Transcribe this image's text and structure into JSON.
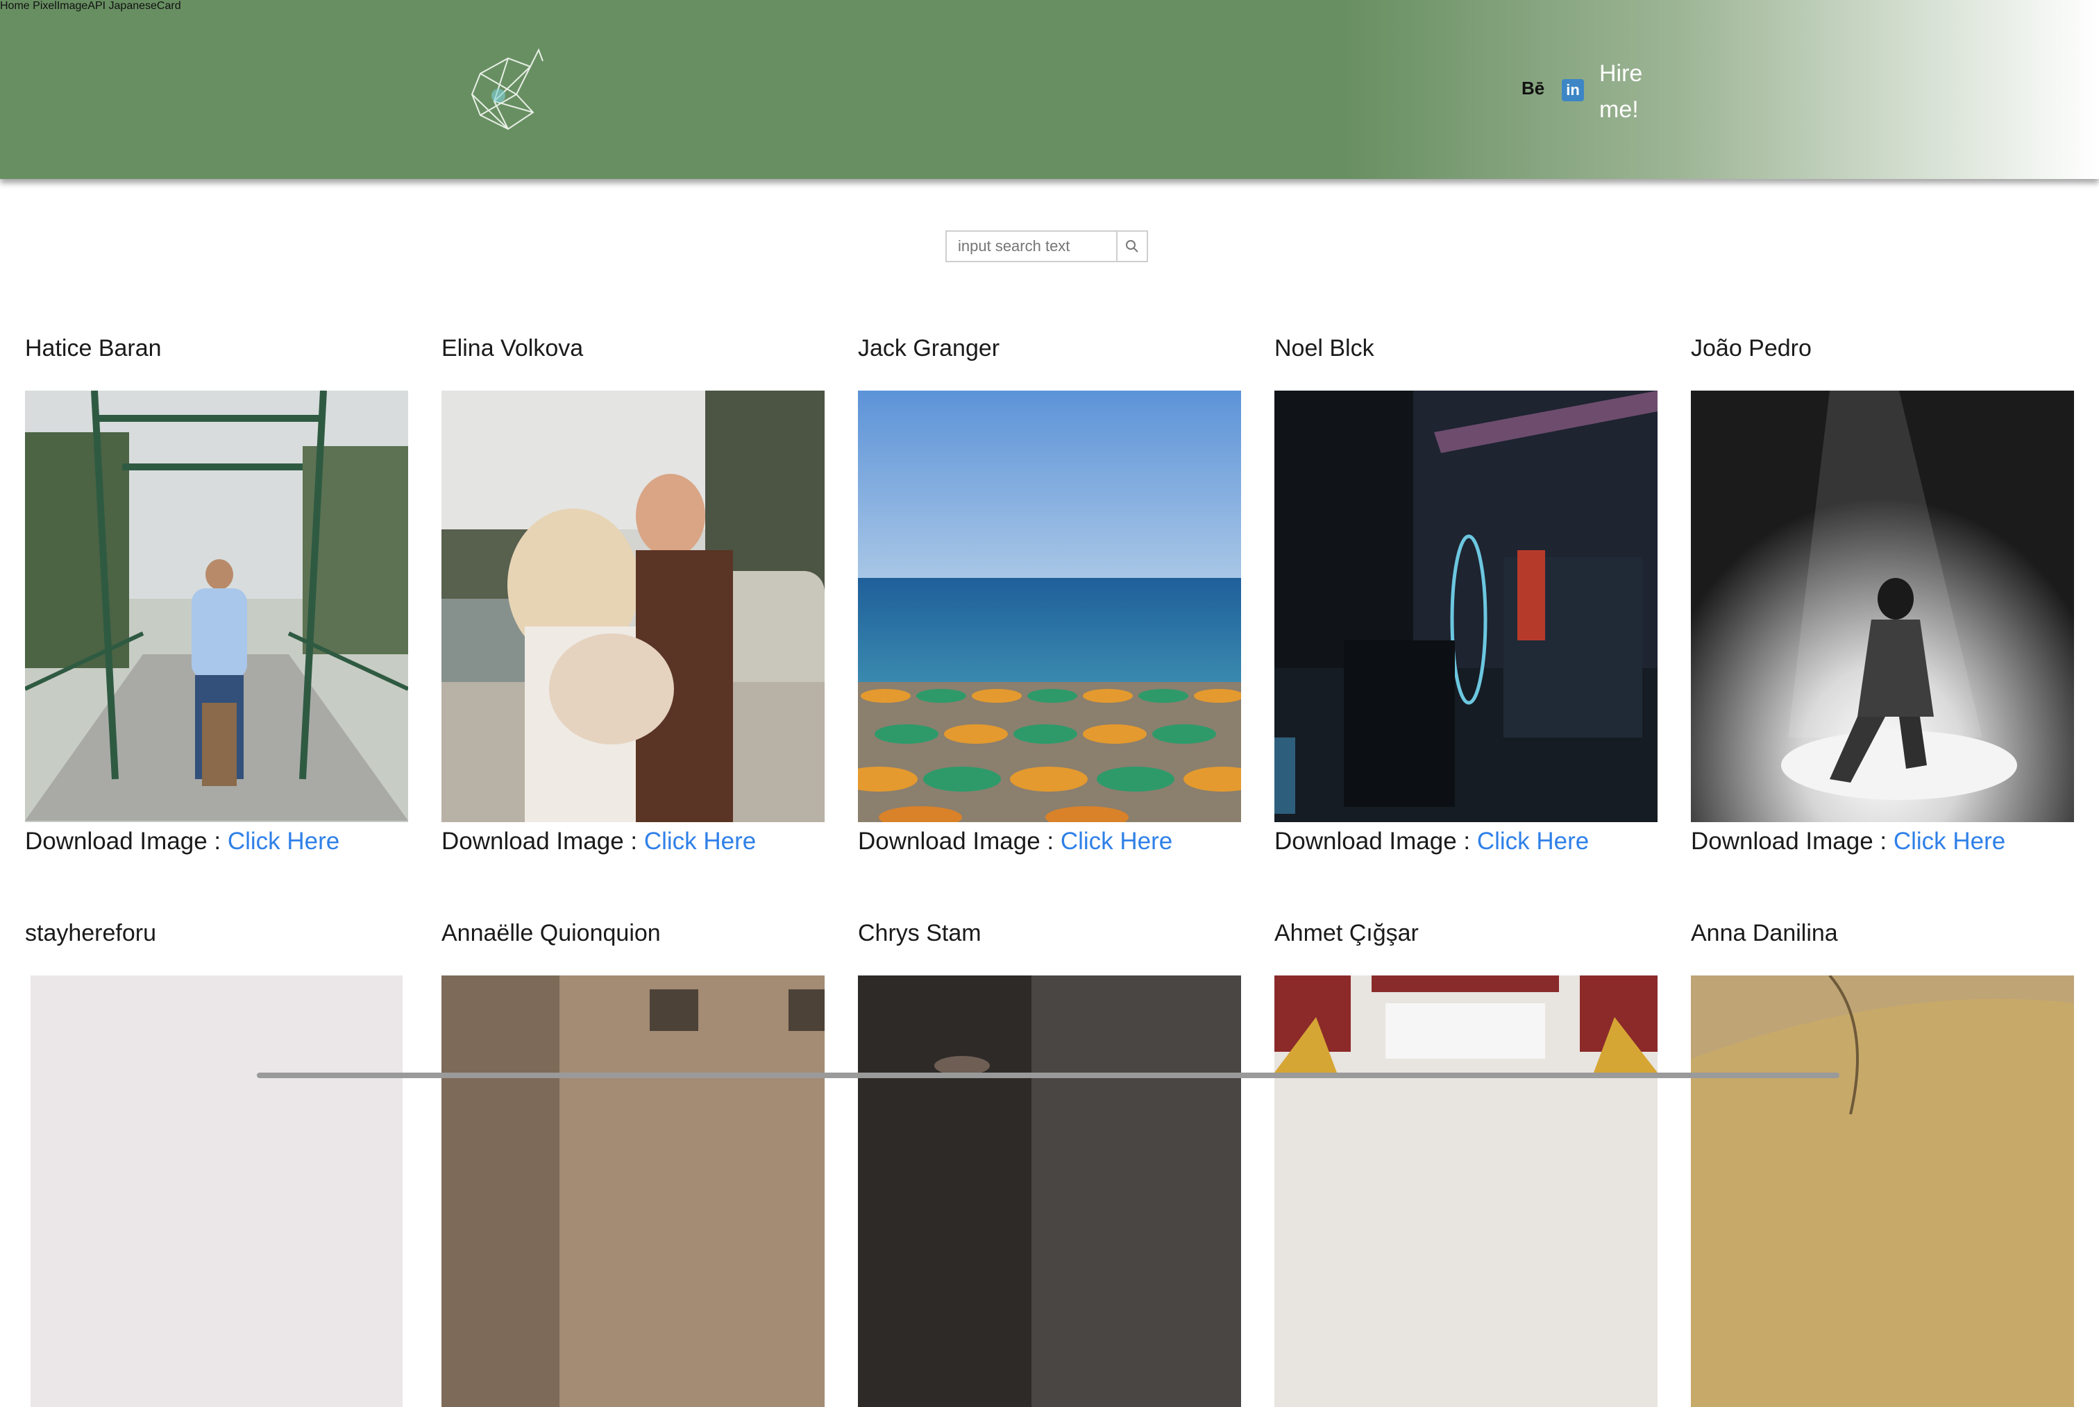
{
  "header": {
    "nav": [
      {
        "label": "Home"
      },
      {
        "label": "PixelImageAPI"
      },
      {
        "label": "JapaneseCard"
      }
    ],
    "behance_label": "Bē",
    "linkedin_label": "in",
    "hire_label": "Hire me!"
  },
  "search": {
    "placeholder": "input search text"
  },
  "download_label": "Download Image :",
  "link_label": "Click Here",
  "photos": [
    {
      "author": "Hatice Baran"
    },
    {
      "author": "Elina Volkova"
    },
    {
      "author": "Jack Granger"
    },
    {
      "author": "Noel Blck"
    },
    {
      "author": "João Pedro"
    },
    {
      "author": "stayhereforu"
    },
    {
      "author": "Annaëlle Quionquion"
    },
    {
      "author": "Chrys Stam"
    },
    {
      "author": "Ahmet Çığşar"
    },
    {
      "author": "Anna Danilina"
    }
  ],
  "colors": {
    "header_green": "#688f62",
    "link_blue": "#2f80e8",
    "linkedin_blue": "#3d86c6"
  }
}
